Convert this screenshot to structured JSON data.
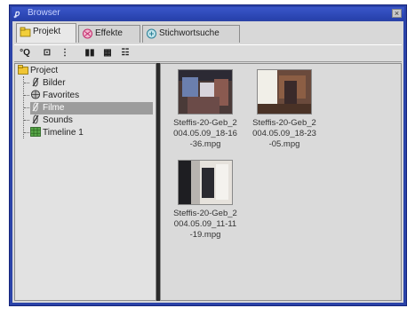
{
  "window": {
    "title": "Browser",
    "close_glyph": "×"
  },
  "tabs": [
    {
      "label": "Projekt",
      "icon": "project-icon",
      "active": true
    },
    {
      "label": "Effekte",
      "icon": "effects-icon",
      "active": false
    },
    {
      "label": "Stichwortsuche",
      "icon": "keyword-search-icon",
      "active": false
    }
  ],
  "toolbar": {
    "buttons": [
      {
        "label": "°Q",
        "name": "search-button"
      },
      {
        "label": "⊡",
        "name": "new-folder-button"
      },
      {
        "label": "⋮",
        "name": "info-button"
      },
      {
        "label": "▮▮",
        "name": "large-icons-button"
      },
      {
        "label": "▦",
        "name": "small-icons-button"
      },
      {
        "label": "☷",
        "name": "list-view-button"
      }
    ]
  },
  "tree": {
    "root": "Project",
    "items": [
      "Bilder",
      "Favorites",
      "Filme",
      "Sounds",
      "Timeline 1"
    ],
    "selected": "Filme"
  },
  "files": [
    {
      "caption": [
        "Steffis-20-Geb_2",
        "004.05.09_18-16",
        "-36.mpg"
      ]
    },
    {
      "caption": [
        "Steffis-20-Geb_2",
        "004.05.09_18-23",
        "-05.mpg"
      ]
    },
    {
      "caption": [
        "Steffis-20-Geb_2",
        "004.05.09_11-11",
        "-19.mpg"
      ]
    }
  ]
}
